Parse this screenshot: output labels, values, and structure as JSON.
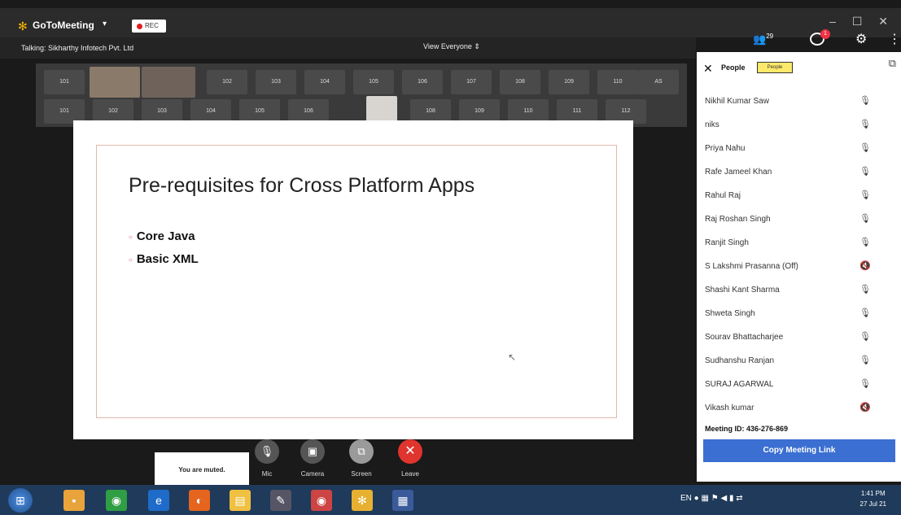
{
  "titlebar": {
    "app_name": "GoToMeeting",
    "caret": "▾",
    "rec_label": "REC",
    "window_controls": "– ☐ ✕"
  },
  "subbar": {
    "talking": "Talking: Sikharthy Infotech Pvt. Ltd",
    "view": "View Everyone ⇕"
  },
  "top_right": {
    "people_count": "29",
    "notif": "1"
  },
  "tiles": [
    "101",
    "",
    "",
    "102",
    "103",
    "104",
    "105",
    "106",
    "107",
    "108",
    "109",
    "110",
    "AS",
    "",
    "101",
    "102",
    "103",
    "104",
    "105",
    "106",
    "107",
    "",
    "108",
    "109",
    "110",
    "111",
    "112"
  ],
  "slide": {
    "title": "Pre-requisites for Cross Platform Apps",
    "bullets": [
      "Core Java",
      "Basic XML"
    ]
  },
  "toolbar": {
    "muted_toast": "You are muted.",
    "mic": "Mic",
    "camera": "Camera",
    "screen": "Screen",
    "leave": "Leave"
  },
  "panel": {
    "title": "People",
    "tab": "People",
    "people": [
      {
        "name": "Nikhil Kumar Saw",
        "mic": "🎙"
      },
      {
        "name": "niks",
        "mic": "🎙"
      },
      {
        "name": "Priya Nahu",
        "mic": "🎙"
      },
      {
        "name": "Rafe Jameel Khan",
        "mic": "🎙"
      },
      {
        "name": "Rahul Raj",
        "mic": "🎙"
      },
      {
        "name": "Raj Roshan Singh",
        "mic": "🎙"
      },
      {
        "name": "Ranjit Singh",
        "mic": "🎙"
      },
      {
        "name": "S Lakshmi Prasanna (Off)",
        "mic": "🔇"
      },
      {
        "name": "Shashi Kant Sharma",
        "mic": "🎙"
      },
      {
        "name": "Shweta Singh",
        "mic": "🎙"
      },
      {
        "name": "Sourav Bhattacharjee",
        "mic": "🎙"
      },
      {
        "name": "Sudhanshu Ranjan",
        "mic": "🎙"
      },
      {
        "name": "SURAJ AGARWAL",
        "mic": "🎙"
      },
      {
        "name": "Vikash kumar",
        "mic": "🔇"
      }
    ],
    "meeting_id": "Meeting ID: 436-276-869",
    "copy_link": "Copy Meeting Link"
  },
  "taskbar": {
    "tray": "EN",
    "time": "1:41 PM",
    "date": "27 Jul 21"
  }
}
